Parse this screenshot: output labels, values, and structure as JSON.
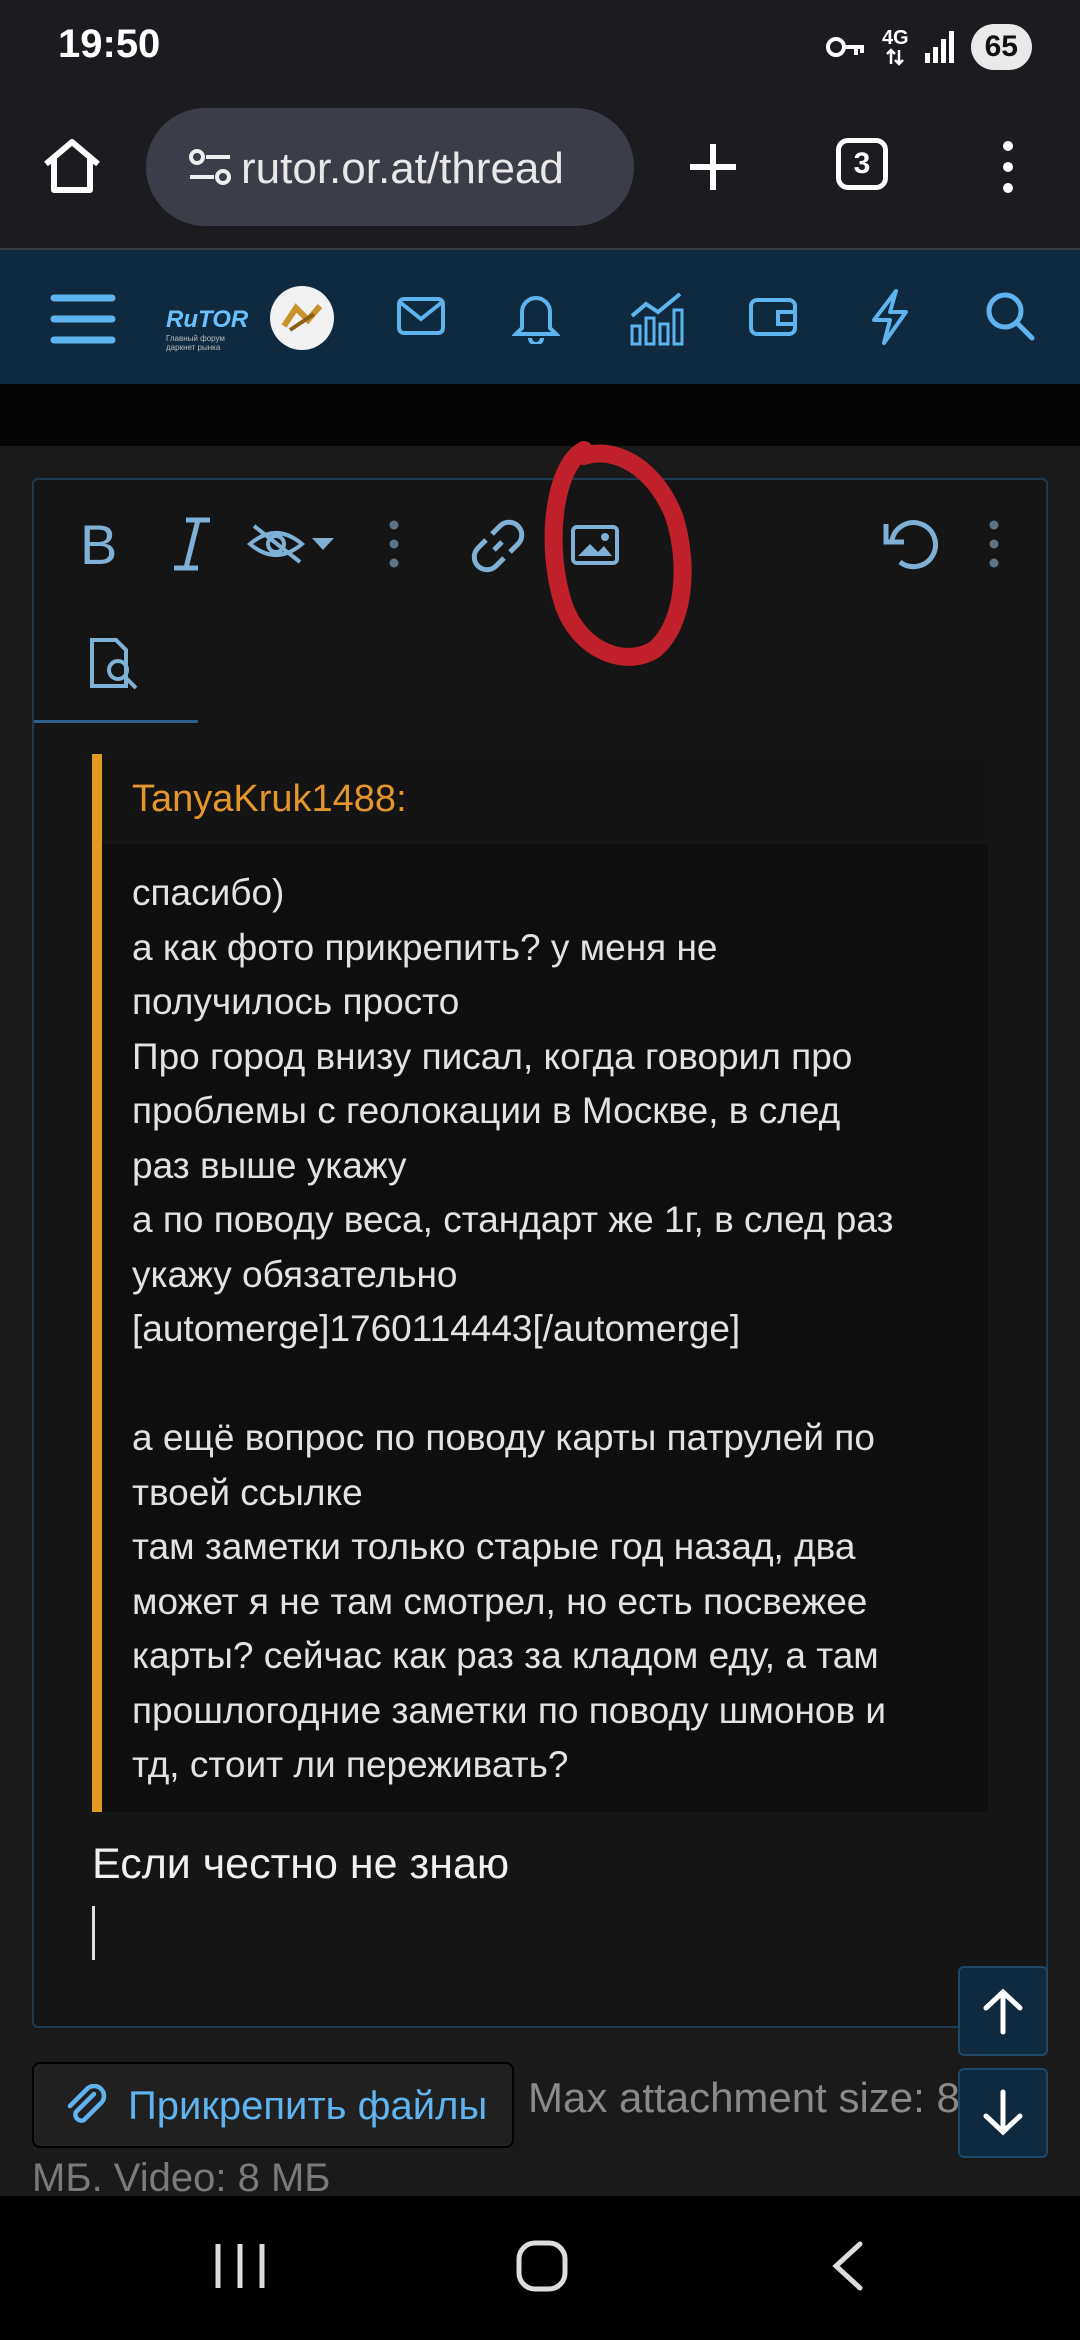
{
  "status_bar": {
    "time": "19:50",
    "network": "4G",
    "battery": "65"
  },
  "browser": {
    "url": "rutor.or.at/thread",
    "tab_count": "3"
  },
  "site": {
    "logo_text": "RuTOR",
    "logo_subtitle": "Главный форум даркнет рынка"
  },
  "editor": {
    "quote_author": "TanyaKruk1488:",
    "quote_lines": [
      "спасибо)",
      "а как фото прикрепить? у меня не",
      "получилось просто",
      "Про город внизу писал, когда говорил про",
      "проблемы с геолокации в Москве, в след",
      "раз выше укажу",
      "а по поводу веса, стандарт же 1г, в след раз",
      "укажу обязательно",
      "[automerge]1760114443[/automerge]",
      "",
      "а ещё вопрос по поводу карты патрулей по",
      "твоей ссылке",
      "там заметки только старые год назад, два",
      "может я не там смотрел, но есть посвежее",
      "карты? сейчас как раз за кладом еду, а там",
      "прошлогодние заметки по поводу шмонов и",
      "тд, стоит ли переживать?"
    ],
    "reply_text": "Если честно не знаю"
  },
  "attachments": {
    "button_label": "Прикрепить файлы",
    "max_size_text": "Max attachment size: 8",
    "video_size_text": "МБ. Video: 8 МБ"
  },
  "colors": {
    "accent": "#5fb4ef",
    "nav_bg": "#0f2a3e",
    "quote_bar": "#e39a21",
    "annotation": "#c0202a"
  }
}
